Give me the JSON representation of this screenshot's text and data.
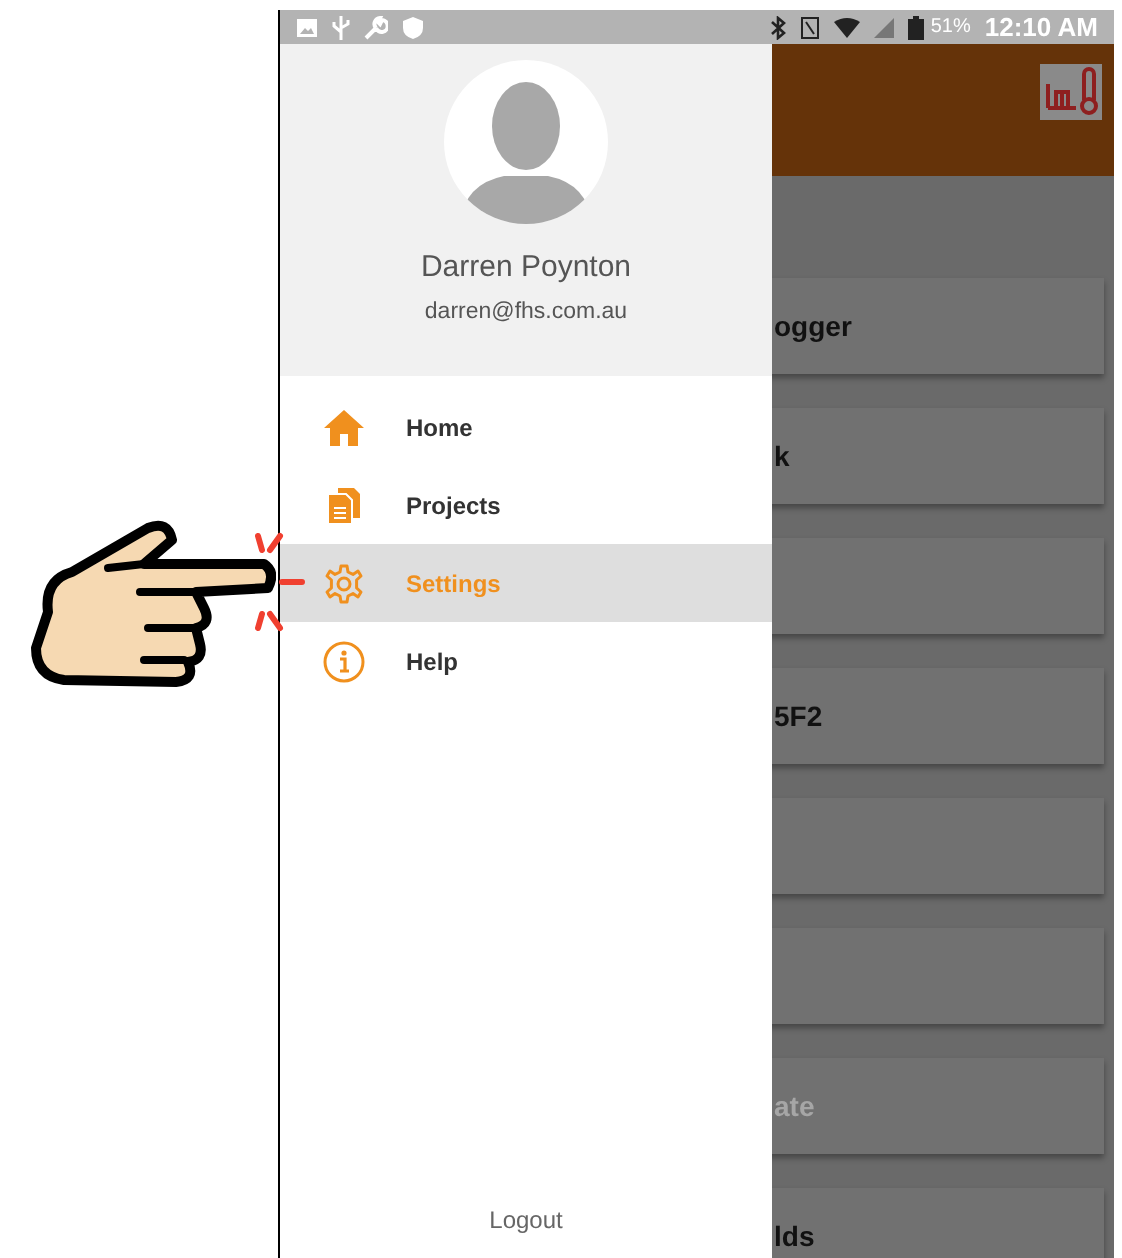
{
  "status_bar": {
    "battery": "51%",
    "time": "12:10 AM"
  },
  "drawer": {
    "user": {
      "name": "Darren Poynton",
      "email": "darren@fhs.com.au"
    },
    "menu": [
      {
        "label": "Home",
        "selected": false
      },
      {
        "label": "Projects",
        "selected": false
      },
      {
        "label": "Settings",
        "selected": true
      },
      {
        "label": "Help",
        "selected": false
      }
    ],
    "footer": "Logout"
  },
  "background_list": [
    {
      "kind": "titled",
      "text": "ogger",
      "disabled": false
    },
    {
      "kind": "titled",
      "text": "k",
      "disabled": false
    },
    {
      "kind": "blank"
    },
    {
      "kind": "titled",
      "text": "5F2",
      "disabled": false
    },
    {
      "kind": "blank"
    },
    {
      "kind": "blank"
    },
    {
      "kind": "titled",
      "text": "ate",
      "disabled": true
    },
    {
      "kind": "titled",
      "text": "lds",
      "disabled": false
    }
  ]
}
